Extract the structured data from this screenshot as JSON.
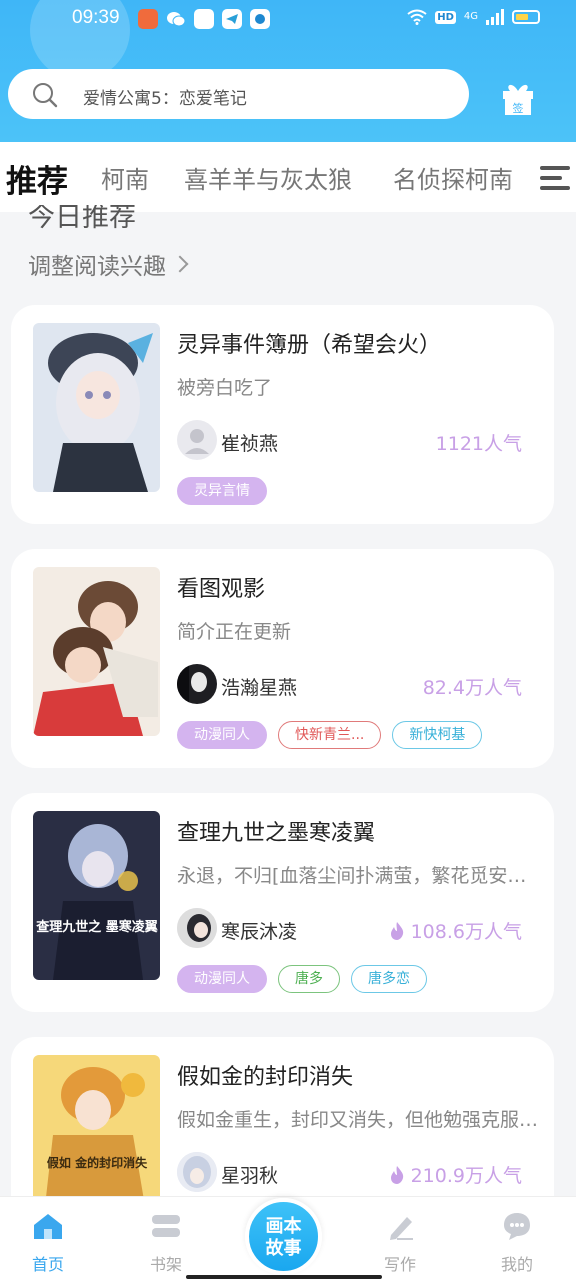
{
  "status_bar": {
    "time": "09:39",
    "network": "4G",
    "hd": "HD"
  },
  "search": {
    "placeholder": "爱情公寓5：恋爱笔记"
  },
  "checkin": {
    "label": "签"
  },
  "tabs": [
    "推荐",
    "柯南",
    "喜羊羊与灰太狼",
    "名侦探柯南"
  ],
  "feed": {
    "section_title": "今日推荐",
    "adjust_label": "调整阅读兴趣"
  },
  "cards": [
    {
      "title": "灵异事件簿册（希望会火）",
      "desc": "被旁白吃了",
      "author": "崔祯燕",
      "popularity": "1121人气",
      "hot": false,
      "tags": [
        {
          "text": "灵异言情",
          "style": "purple"
        }
      ]
    },
    {
      "title": "看图观影",
      "desc": "简介正在更新",
      "author": "浩瀚星燕",
      "popularity": "82.4万人气",
      "hot": false,
      "tags": [
        {
          "text": "动漫同人",
          "style": "purple"
        },
        {
          "text": "快新青兰...",
          "style": "red"
        },
        {
          "text": "新快柯基",
          "style": "cyan"
        }
      ]
    },
    {
      "title": "查理九世之墨寒凌翼",
      "desc": "永退，不归[血落尘间扑满萤，繁花觅安…",
      "author": "寒辰沐凌",
      "popularity": "108.6万人气",
      "hot": true,
      "cover_text": "查理九世之 墨寒凌翼",
      "tags": [
        {
          "text": "动漫同人",
          "style": "purple"
        },
        {
          "text": "唐多",
          "style": "green"
        },
        {
          "text": "唐多恋",
          "style": "cyan"
        }
      ]
    },
    {
      "title": "假如金的封印消失",
      "desc": "假如金重生，封印又消失，但他勉强克服…",
      "author": "星羽秋",
      "popularity": "210.9万人气",
      "hot": true,
      "cover_text": "假如 金的封印消失",
      "tags": []
    }
  ],
  "bottom_nav": {
    "home": "首页",
    "shelf": "书架",
    "center": "画本故事",
    "write": "写作",
    "mine": "我的"
  },
  "colors": {
    "brand": "#3fb6f7",
    "accent_purple": "#c8a0e6",
    "tag_purple": "#d4b4ef"
  }
}
